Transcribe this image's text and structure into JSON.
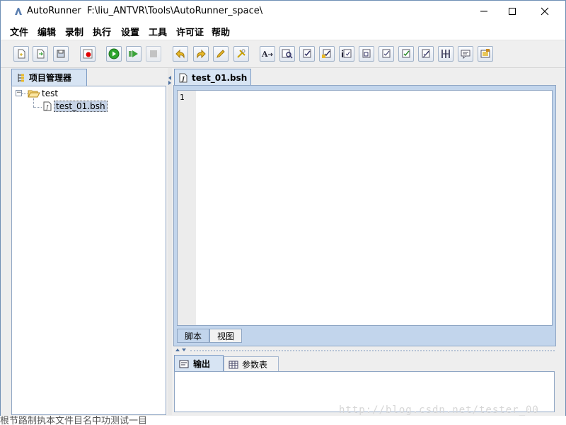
{
  "window": {
    "app_name": "AutoRunner",
    "path": "F:\\liu_ANTVR\\Tools\\AutoRunner_space\\"
  },
  "menu": [
    "文件",
    "编辑",
    "录制",
    "执行",
    "设置",
    "工具",
    "许可证",
    "帮助"
  ],
  "toolbar_icons": [
    "new-file-icon",
    "open-file-icon",
    "save-icon",
    "record-icon",
    "run-icon",
    "step-run-icon",
    "stop-icon",
    "undo-icon",
    "redo-icon",
    "edit-icon",
    "tools-icon",
    "text-icon",
    "find-icon",
    "check-icon",
    "check-icon",
    "info-icon",
    "checkbox-icon",
    "checkbox-icon",
    "checkbox-icon",
    "checkbox-icon",
    "split-icon",
    "comment-icon",
    "image-icon"
  ],
  "left_panel": {
    "tab_label": "项目管理器",
    "tree": {
      "root": "test",
      "root_expander": "−",
      "child": "test_01.bsh"
    }
  },
  "editor": {
    "tab_label": "test_01.bsh",
    "line_number": "1",
    "bottom_tabs": [
      "脚本",
      "视图"
    ]
  },
  "output_panel": {
    "tabs": [
      "输出",
      "参数表"
    ]
  },
  "watermark": "http://blog.csdn.net/tester_00",
  "status_strip": "根节路制执本文件目名中功测试一目"
}
